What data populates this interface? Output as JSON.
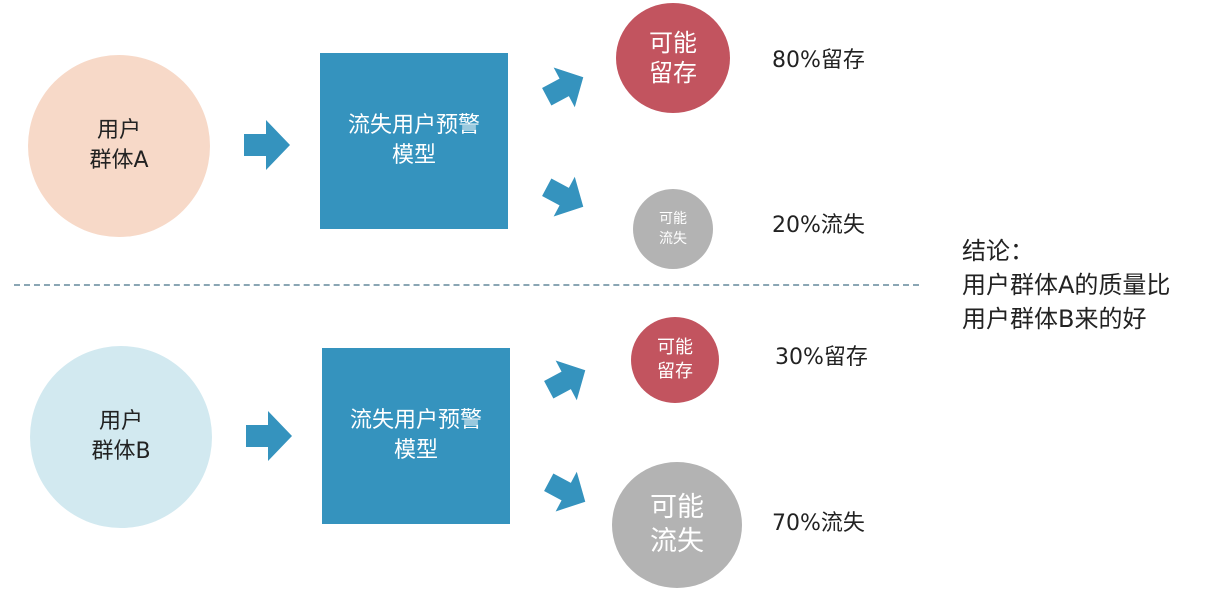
{
  "colors": {
    "group_a": "#f7d9c8",
    "group_b": "#d2e9f0",
    "model_box": "#3593be",
    "arrow": "#3593be",
    "retain": "#c2545f",
    "churn": "#b3b3b3",
    "divider": "#8aa6b4"
  },
  "top": {
    "group": {
      "line1": "用户",
      "line2": "群体A"
    },
    "model": {
      "line1": "流失用户预警",
      "line2": "模型"
    },
    "retain": {
      "line1": "可能",
      "line2": "留存",
      "value": "80%留存"
    },
    "churn": {
      "line1": "可能",
      "line2": "流失",
      "value": "20%流失"
    }
  },
  "bottom": {
    "group": {
      "line1": "用户",
      "line2": "群体B"
    },
    "model": {
      "line1": "流失用户预警",
      "line2": "模型"
    },
    "retain": {
      "line1": "可能",
      "line2": "留存",
      "value": "30%留存"
    },
    "churn": {
      "line1": "可能",
      "line2": "流失",
      "value": "70%流失"
    }
  },
  "conclusion": {
    "title": "结论：",
    "line1": "用户群体A的质量比",
    "line2": "用户群体B来的好"
  }
}
